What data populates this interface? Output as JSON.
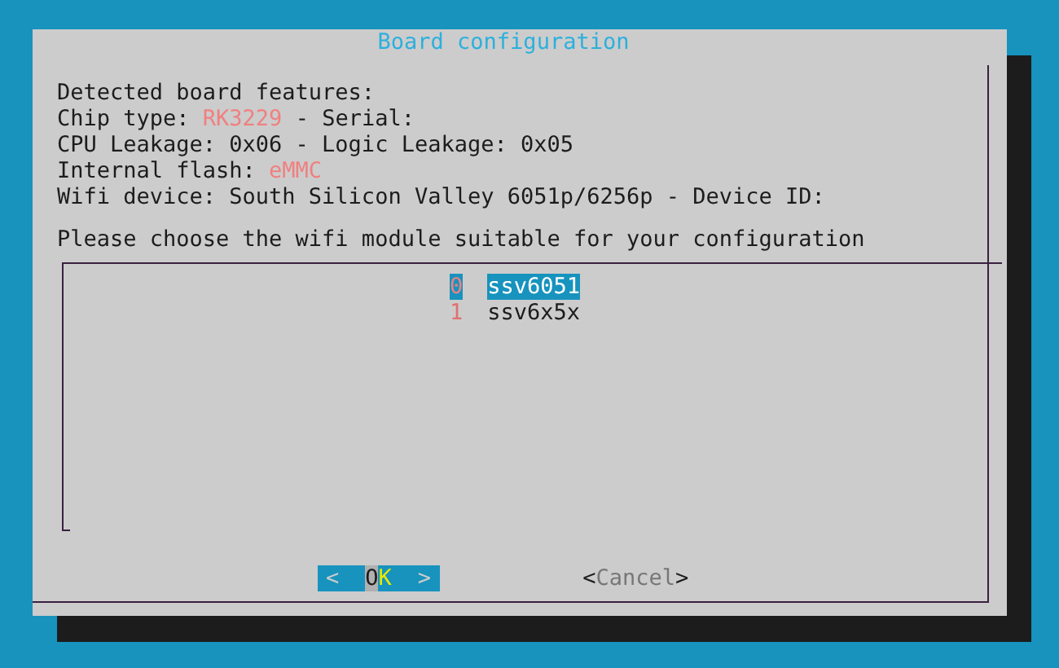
{
  "dialog": {
    "title": "Board configuration",
    "lines": [
      [
        {
          "text": "Detected board features:",
          "kind": "plain"
        }
      ],
      [
        {
          "text": "Chip type: ",
          "kind": "plain"
        },
        {
          "text": "RK3229",
          "kind": "value"
        },
        {
          "text": " - Serial:",
          "kind": "plain"
        }
      ],
      [
        {
          "text": "CPU Leakage: 0x06 - Logic Leakage: 0x05",
          "kind": "plain"
        }
      ],
      [
        {
          "text": "Internal flash: ",
          "kind": "plain"
        },
        {
          "text": "eMMC",
          "kind": "value"
        }
      ],
      [
        {
          "text": "Wifi device: South Silicon Valley 6051p/6256p - Device ID:",
          "kind": "plain"
        }
      ]
    ],
    "prompt": "Please choose the wifi module suitable for your configuration",
    "items": [
      {
        "tag": "0",
        "item": "ssv6051",
        "selected": true
      },
      {
        "tag": "1",
        "item": "ssv6x5x",
        "selected": false
      }
    ],
    "buttons": [
      {
        "open": "<",
        "label": "OK",
        "close": ">",
        "selected": true
      },
      {
        "open": "<",
        "label": "Cancel",
        "close": ">",
        "selected": false
      }
    ]
  }
}
